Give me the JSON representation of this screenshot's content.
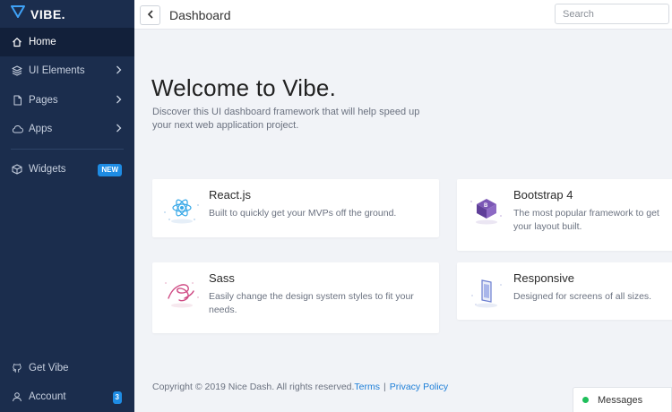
{
  "brand": {
    "name": "VIBE."
  },
  "sidebar": {
    "items": [
      {
        "label": "Home",
        "icon": "home-icon"
      },
      {
        "label": "UI Elements",
        "icon": "layers-icon"
      },
      {
        "label": "Pages",
        "icon": "file-icon"
      },
      {
        "label": "Apps",
        "icon": "cloud-icon"
      },
      {
        "label": "Widgets",
        "icon": "box-icon",
        "badge": "NEW"
      }
    ],
    "bottom": [
      {
        "label": "Get Vibe",
        "icon": "github-icon"
      },
      {
        "label": "Account",
        "icon": "user-icon",
        "badge": "3"
      }
    ]
  },
  "header": {
    "title": "Dashboard",
    "search_placeholder": "Search"
  },
  "main": {
    "title": "Welcome to Vibe.",
    "subtitle": "Discover this UI dashboard framework that will help speed up your next web application project.",
    "cards": [
      {
        "title": "React.js",
        "desc": "Built to quickly get your MVPs off the ground."
      },
      {
        "title": "Bootstrap 4",
        "desc": "The most popular framework to get your layout built."
      },
      {
        "title": "Sass",
        "desc": "Easily change the design system styles to fit your needs."
      },
      {
        "title": "Responsive",
        "desc": "Designed for screens of all sizes."
      }
    ]
  },
  "footer": {
    "copyright": "Copyright © 2019 Nice Dash. All rights reserved.",
    "terms": "Terms",
    "separator": "|",
    "privacy": "Privacy Policy"
  },
  "messages": {
    "label": "Messages",
    "status_color": "#1fbf5b"
  },
  "colors": {
    "sidebar": "#1b2d4d",
    "sidebar_active": "#12203a",
    "accent": "#1e8ce4",
    "background": "#f1f3f7"
  }
}
